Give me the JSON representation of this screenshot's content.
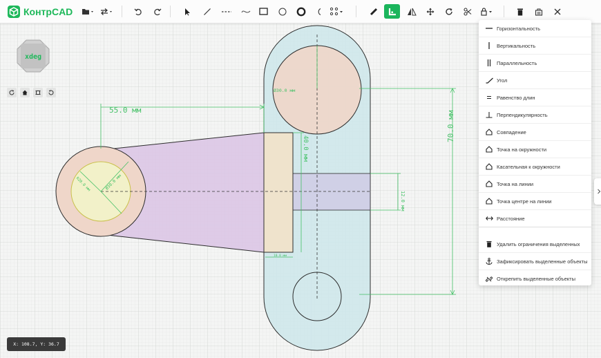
{
  "app": {
    "title": "КонтрCAD",
    "brand_color": "#1eb85a"
  },
  "toolbar": {
    "groups": [
      "file",
      "transfer",
      "undo-redo",
      "draw",
      "constraints",
      "edit"
    ],
    "active_tool": "constraint-tool",
    "icons": [
      "folder-icon",
      "swap-icon",
      "undo-icon",
      "redo-icon",
      "cursor-icon",
      "line-icon",
      "dashed-line-icon",
      "spline-icon",
      "rectangle-icon",
      "circle-icon",
      "ring-icon",
      "arc-icon",
      "points-icon",
      "ruler-icon",
      "constraint-icon",
      "mirror-icon",
      "move-icon",
      "rotate-icon",
      "scissors-icon",
      "lock-icon",
      "trash-icon",
      "stamp-icon",
      "close-icon"
    ]
  },
  "view_cube": {
    "label": "xdeg"
  },
  "coords": {
    "text": "X: 108.7, Y: 36.7"
  },
  "dimensions": {
    "d1": "55.0 мм",
    "d2": "70.0 мм",
    "d3": "40.0 мм",
    "d4": "12.0 мм",
    "d5": "Ø30.0 мм",
    "d6": "Ø30.0 мм",
    "d7": "R20.0 мм",
    "d8": "10.0 мм"
  },
  "constraints_panel": {
    "items": [
      {
        "icon": "horizontal-icon",
        "label": "Горизонтальность"
      },
      {
        "icon": "vertical-icon",
        "label": "Вертикальность"
      },
      {
        "icon": "parallel-icon",
        "label": "Параллельность"
      },
      {
        "icon": "angle-icon",
        "label": "Угол"
      },
      {
        "icon": "equal-icon",
        "label": "Равенство длин"
      },
      {
        "icon": "perpendicular-icon",
        "label": "Перпендикулярность"
      },
      {
        "icon": "coincident-icon",
        "label": "Совпадение"
      },
      {
        "icon": "point-on-circle-icon",
        "label": "Точка на окружности"
      },
      {
        "icon": "tangent-icon",
        "label": "Касательная к окружности"
      },
      {
        "icon": "point-on-line-icon",
        "label": "Точка на линии"
      },
      {
        "icon": "midpoint-icon",
        "label": "Точка центре на линии"
      },
      {
        "icon": "distance-icon",
        "label": "Расстояние"
      }
    ],
    "actions": [
      {
        "icon": "trash-icon",
        "label": "Удалить ограничения выделенных"
      },
      {
        "icon": "anchor-icon",
        "label": "Зафиксировать выделенные объекты"
      },
      {
        "icon": "unlink-icon",
        "label": "Открепить выделенные объекты"
      }
    ]
  },
  "colors": {
    "grid_minor": "#e4e6e4",
    "grid_major": "#d2d5d2",
    "dim": "#45c167",
    "fill_blue": "#cde6ea",
    "fill_peach": "#efd6c9",
    "fill_purple": "#dcc7e6",
    "fill_yellow": "#f2f1c9",
    "fill_beige": "#efe3cc",
    "fill_lavender": "#cfcde6"
  }
}
